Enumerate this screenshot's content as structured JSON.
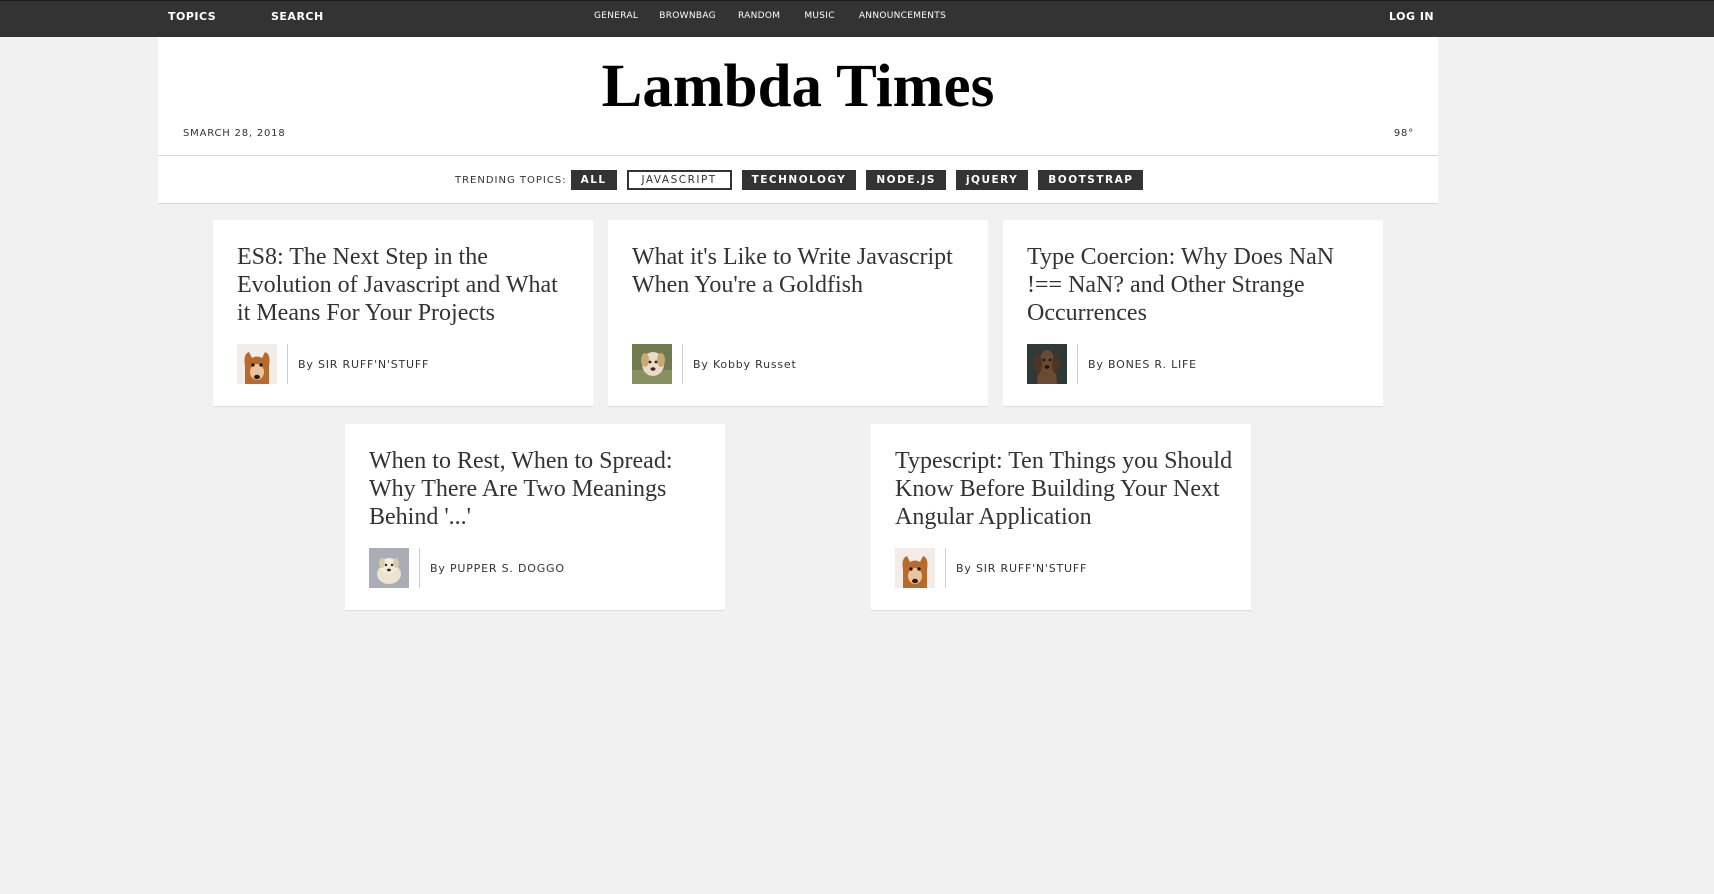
{
  "top_bar": {
    "topics": "TOPICS",
    "search": "SEARCH",
    "nav": [
      "GENERAL",
      "BROWNBAG",
      "RANDOM",
      "MUSIC",
      "ANNOUNCEMENTS"
    ],
    "login": "LOG IN"
  },
  "header": {
    "title": "Lambda Times",
    "date": "SMARCH 28, 2018",
    "temperature": "98°"
  },
  "topics": {
    "label": "TRENDING TOPICS:",
    "tabs": [
      "ALL",
      "JAVASCRIPT",
      "TECHNOLOGY",
      "NODE.JS",
      "jQUERY",
      "BOOTSTRAP"
    ],
    "active": "JAVASCRIPT"
  },
  "cards": [
    {
      "headline": "ES8: The Next Step in the Evolution of Javascript and What it Means For Your Projects",
      "author": "By SIR RUFF'N'STUFF",
      "avatar": "dog-photo"
    },
    {
      "headline": "What it's Like to Write Javascript When You're a Goldfish",
      "author": "By Kobby Russet",
      "avatar": "dog-photo"
    },
    {
      "headline": "Type Coercion: Why Does NaN !== NaN? and Other Strange Occurrences",
      "author": "By BONES R. LIFE",
      "avatar": "dog-photo"
    },
    {
      "headline": "When to Rest, When to Spread: Why There Are Two Meanings Behind '...'",
      "author": "By PUPPER S. DOGGO",
      "avatar": "dog-photo"
    },
    {
      "headline": "Typescript: Ten Things you Should Know Before Building Your Next Angular Application",
      "author": "By SIR RUFF'N'STUFF",
      "avatar": "dog-photo"
    }
  ],
  "colors": {
    "bar": "#333333",
    "page_background": "#f1f1f1",
    "card_background": "#ffffff"
  }
}
